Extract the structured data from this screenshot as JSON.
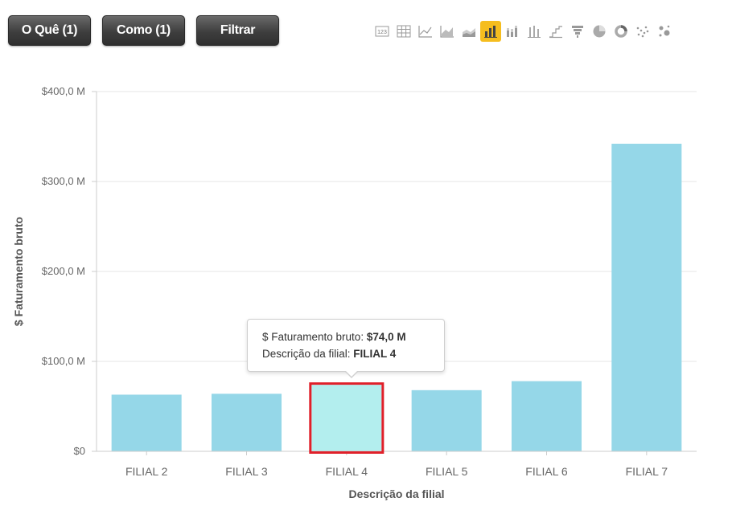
{
  "toolbar": {
    "what_label": "O Quê (1)",
    "how_label": "Como (1)",
    "filter_label": "Filtrar"
  },
  "chart_types": [
    {
      "name": "number-icon"
    },
    {
      "name": "table-icon"
    },
    {
      "name": "line-chart-icon"
    },
    {
      "name": "area-chart-icon"
    },
    {
      "name": "stacked-area-chart-icon"
    },
    {
      "name": "bar-chart-icon",
      "active": true
    },
    {
      "name": "stacked-bar-chart-icon"
    },
    {
      "name": "range-bar-chart-icon"
    },
    {
      "name": "step-chart-icon"
    },
    {
      "name": "funnel-chart-icon"
    },
    {
      "name": "pie-chart-icon"
    },
    {
      "name": "donut-chart-icon"
    },
    {
      "name": "scatter-chart-icon"
    },
    {
      "name": "bubble-chart-icon"
    }
  ],
  "colors": {
    "bar": "#95d7e8",
    "bar_highlight": "#b3eeee",
    "highlight_border": "#e0202a",
    "grid": "#e6e6e6",
    "active_chart_type": "#f5bd1f"
  },
  "chart_data": {
    "type": "bar",
    "categories": [
      "FILIAL 2",
      "FILIAL 3",
      "FILIAL 4",
      "FILIAL 5",
      "FILIAL 6",
      "FILIAL 7"
    ],
    "values": [
      63,
      64,
      74,
      68,
      78,
      342
    ],
    "xlabel": "Descrição da filial",
    "ylabel": "$ Faturamento bruto",
    "ylim": [
      0,
      400
    ],
    "yticks": [
      0,
      100,
      200,
      300,
      400
    ],
    "ytick_labels": [
      "$0",
      "$100,0 M",
      "$200,0 M",
      "$300,0 M",
      "$400,0 M"
    ],
    "grid": true,
    "highlighted_index": 2
  },
  "tooltip": {
    "line1_label": "$ Faturamento bruto: ",
    "line1_value": "$74,0 M",
    "line2_label": "Descrição da filial: ",
    "line2_value": "FILIAL 4"
  }
}
